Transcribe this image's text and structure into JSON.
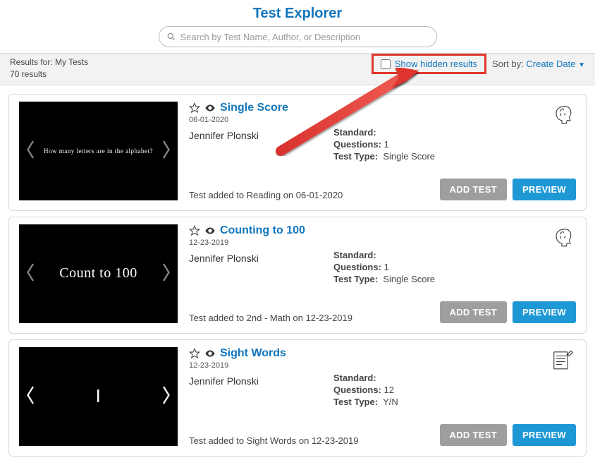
{
  "page_title": "Test Explorer",
  "search": {
    "placeholder": "Search by Test Name, Author, or Description"
  },
  "results": {
    "for_label": "Results for: My Tests",
    "count_label": "70 results",
    "show_hidden_label": "Show hidden results",
    "sort_label": "Sort by:",
    "sort_value": "Create Date"
  },
  "labels": {
    "standard": "Standard:",
    "questions": "Questions:",
    "test_type": "Test Type:",
    "add_test": "ADD TEST",
    "preview": "PREVIEW"
  },
  "tests": [
    {
      "title": "Single Score",
      "date": "06-01-2020",
      "author": "Jennifer Plonski",
      "standard": "",
      "questions": "1",
      "test_type": "Single Score",
      "added_line": "Test added to Reading on 06-01-2020",
      "thumb_text": "How many letters are in the alphabet?",
      "icon": "brain"
    },
    {
      "title": "Counting to 100",
      "date": "12-23-2019",
      "author": "Jennifer Plonski",
      "standard": "",
      "questions": "1",
      "test_type": "Single Score",
      "added_line": "Test added to 2nd - Math on 12-23-2019",
      "thumb_text": "Count to 100",
      "icon": "brain"
    },
    {
      "title": "Sight Words",
      "date": "12-23-2019",
      "author": "Jennifer Plonski",
      "standard": "",
      "questions": "12",
      "test_type": "Y/N",
      "added_line": "Test added to Sight Words on 12-23-2019",
      "thumb_text": "I",
      "icon": "worksheet"
    }
  ]
}
